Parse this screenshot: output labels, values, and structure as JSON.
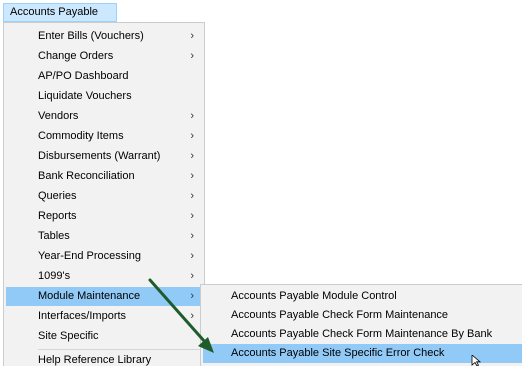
{
  "menubar": {
    "title": "Accounts Payable"
  },
  "menu": {
    "items": [
      {
        "label": "Enter Bills (Vouchers)",
        "arrow": "›"
      },
      {
        "label": "Change Orders",
        "arrow": "›"
      },
      {
        "label": "AP/PO Dashboard",
        "arrow": ""
      },
      {
        "label": "Liquidate Vouchers",
        "arrow": ""
      },
      {
        "label": "Vendors",
        "arrow": "›"
      },
      {
        "label": "Commodity Items",
        "arrow": "›"
      },
      {
        "label": "Disbursements (Warrant)",
        "arrow": "›"
      },
      {
        "label": "Bank Reconciliation",
        "arrow": "›"
      },
      {
        "label": "Queries",
        "arrow": "›"
      },
      {
        "label": "Reports",
        "arrow": "›"
      },
      {
        "label": "Tables",
        "arrow": "›"
      },
      {
        "label": "Year-End Processing",
        "arrow": "›"
      },
      {
        "label": "1099's",
        "arrow": "›"
      },
      {
        "label": "Module Maintenance",
        "arrow": "›"
      },
      {
        "label": "Interfaces/Imports",
        "arrow": "›"
      },
      {
        "label": "Site Specific",
        "arrow": ""
      },
      {
        "label": "Help Reference Library",
        "arrow": ""
      }
    ]
  },
  "submenu": {
    "items": [
      {
        "label": "Accounts Payable Module Control"
      },
      {
        "label": "Accounts Payable Check Form Maintenance"
      },
      {
        "label": "Accounts Payable Check Form Maintenance By Bank"
      },
      {
        "label": "Accounts Payable Site Specific Error Check"
      }
    ]
  },
  "colors": {
    "annotation_arrow": "#1f5c2b",
    "highlight": "#91c9f7",
    "menu_background": "#f2f2f2"
  }
}
